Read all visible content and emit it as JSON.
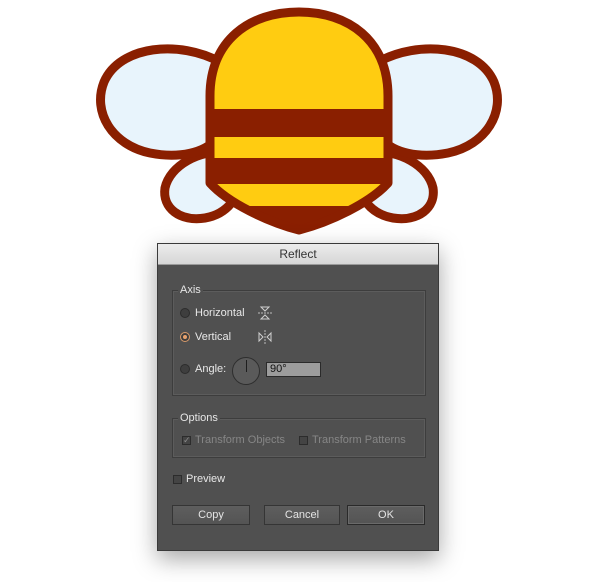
{
  "dialog": {
    "title": "Reflect",
    "axis": {
      "label": "Axis",
      "horizontal_label": "Horizontal",
      "vertical_label": "Vertical",
      "angle_label": "Angle:",
      "angle_value": "90°",
      "selected": "vertical"
    },
    "options": {
      "label": "Options",
      "transform_objects_label": "Transform Objects",
      "transform_objects_checked": true,
      "transform_patterns_label": "Transform Patterns",
      "transform_patterns_checked": false
    },
    "preview_label": "Preview",
    "preview_checked": false,
    "buttons": {
      "copy_label": "Copy",
      "cancel_label": "Cancel",
      "ok_label": "OK"
    }
  },
  "colors": {
    "bee_yellow": "#ffcc11",
    "bee_stripe": "#8a1f00",
    "wing_fill": "#e8f4fc",
    "dialog_bg": "#505050",
    "radio_selected": "#e7a16d"
  },
  "icons": {
    "horizontal_axis": "reflect-horizontal-icon",
    "vertical_axis": "reflect-vertical-icon",
    "angle_dial": "angle-dial-icon"
  }
}
